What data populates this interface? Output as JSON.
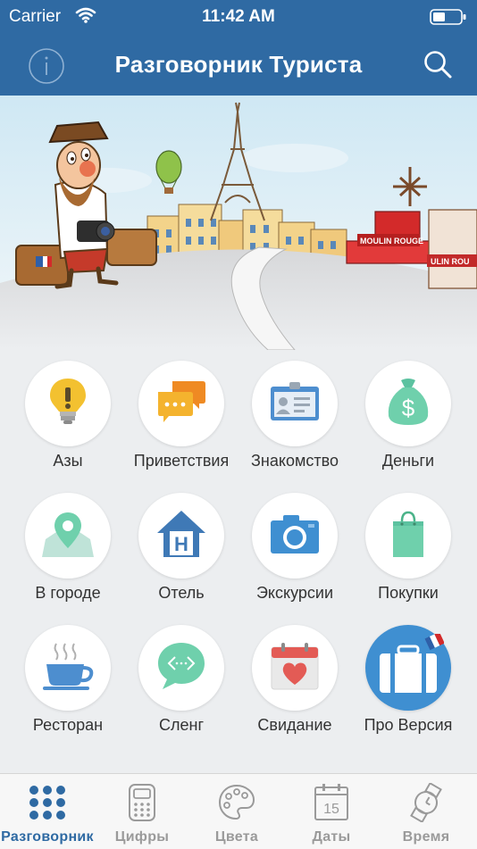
{
  "status_bar": {
    "carrier": "Carrier",
    "time": "11:42 AM"
  },
  "header": {
    "title": "Разговорник Туриста",
    "info_icon": "info-icon",
    "search_icon": "search-icon"
  },
  "colors": {
    "header_bg": "#2f6aa3",
    "accent": "#2f6aa3",
    "icon_inactive": "#9a9a9a"
  },
  "banner": {
    "sign_moulin": "MOULIN ROUGE",
    "sign_side": "ULIN ROU"
  },
  "categories": [
    {
      "label": "Азы",
      "icon": "lightbulb-icon"
    },
    {
      "label": "Приветствия",
      "icon": "chat-bubbles-icon"
    },
    {
      "label": "Знакомство",
      "icon": "id-card-icon"
    },
    {
      "label": "Деньги",
      "icon": "money-bag-icon"
    },
    {
      "label": "В городе",
      "icon": "map-pin-icon"
    },
    {
      "label": "Отель",
      "icon": "hotel-icon"
    },
    {
      "label": "Экскурсии",
      "icon": "camera-icon"
    },
    {
      "label": "Покупки",
      "icon": "shopping-bag-icon"
    },
    {
      "label": "Ресторан",
      "icon": "coffee-cup-icon"
    },
    {
      "label": "Сленг",
      "icon": "code-bubble-icon"
    },
    {
      "label": "Свидание",
      "icon": "calendar-heart-icon"
    },
    {
      "label": "Про Версия",
      "icon": "suitcase-icon"
    }
  ],
  "tabs": [
    {
      "label": "Разговорник",
      "icon": "grid-dots-icon",
      "active": true
    },
    {
      "label": "Цифры",
      "icon": "calculator-icon",
      "active": false
    },
    {
      "label": "Цвета",
      "icon": "palette-icon",
      "active": false
    },
    {
      "label": "Даты",
      "icon": "calendar-icon",
      "active": false,
      "icon_text": "15"
    },
    {
      "label": "Время",
      "icon": "watch-icon",
      "active": false
    }
  ]
}
